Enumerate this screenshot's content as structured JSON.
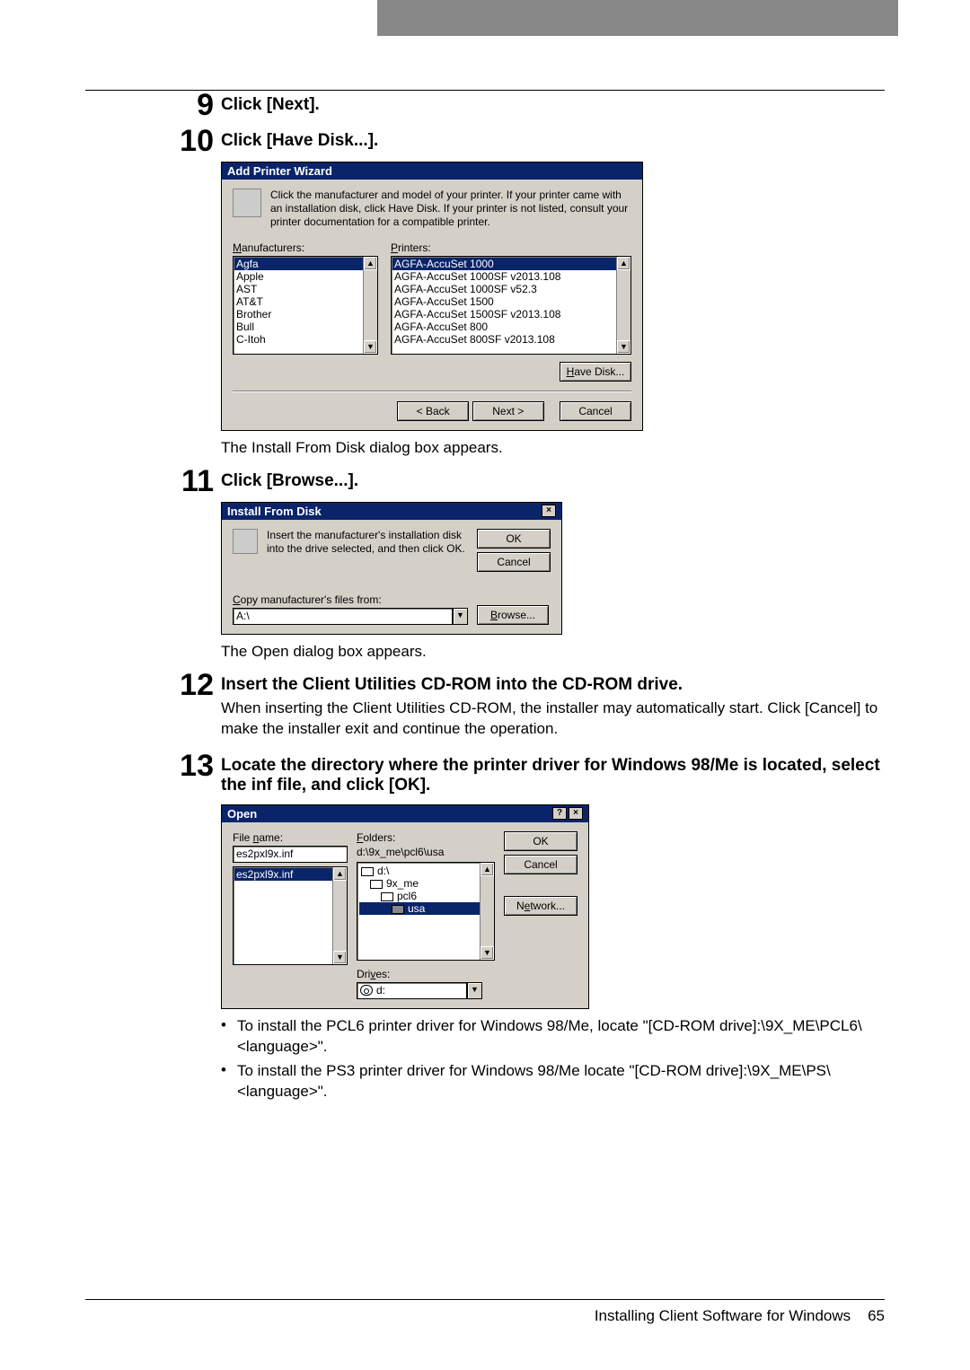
{
  "steps": {
    "s9": {
      "num": "9",
      "title": "Click [Next]."
    },
    "s10": {
      "num": "10",
      "title": "Click [Have Disk...].",
      "after": "The Install From Disk dialog box appears."
    },
    "s11": {
      "num": "11",
      "title": "Click [Browse...].",
      "after": "The Open dialog box appears."
    },
    "s12": {
      "num": "12",
      "title": "Insert the Client Utilities CD-ROM into the CD-ROM drive.",
      "text": "When inserting the Client Utilities CD-ROM, the installer may automatically start. Click [Cancel] to make the installer exit and continue the operation."
    },
    "s13": {
      "num": "13",
      "title": "Locate the directory where the printer driver for Windows 98/Me is located, select the inf file, and click [OK]."
    }
  },
  "bullets": {
    "b1": "To install the PCL6 printer driver for Windows 98/Me, locate \"[CD-ROM drive]:\\9X_ME\\PCL6\\<language>\".",
    "b2": "To install the PS3 printer driver for Windows 98/Me locate \"[CD-ROM drive]:\\9X_ME\\PS\\<language>\"."
  },
  "wizard": {
    "title": "Add Printer Wizard",
    "info": "Click the manufacturer and model of your printer. If your printer came with an installation disk, click Have Disk. If your printer is not listed, consult your printer documentation for a compatible printer.",
    "mfr_label": "Manufacturers:",
    "prn_label": "Printers:",
    "mfrs": [
      "Agfa",
      "Apple",
      "AST",
      "AT&T",
      "Brother",
      "Bull",
      "C-Itoh"
    ],
    "prns": [
      "AGFA-AccuSet 1000",
      "AGFA-AccuSet 1000SF v2013.108",
      "AGFA-AccuSet 1000SF v52.3",
      "AGFA-AccuSet 1500",
      "AGFA-AccuSet 1500SF v2013.108",
      "AGFA-AccuSet 800",
      "AGFA-AccuSet 800SF v2013.108"
    ],
    "have_disk": "Have Disk...",
    "back": "< Back",
    "next": "Next >",
    "cancel": "Cancel"
  },
  "install_from_disk": {
    "title": "Install From Disk",
    "info": "Insert the manufacturer's installation disk into the drive selected, and then click OK.",
    "copy_label": "Copy manufacturer's files from:",
    "path": "A:\\",
    "ok": "OK",
    "cancel": "Cancel",
    "browse": "Browse..."
  },
  "open": {
    "title": "Open",
    "filename_label": "File name:",
    "filename": "es2pxl9x.inf",
    "file_list": [
      "es2pxl9x.inf"
    ],
    "folders_label": "Folders:",
    "path": "d:\\9x_me\\pcl6\\usa",
    "folder_tree": [
      "d:\\",
      "9x_me",
      "pcl6",
      "usa"
    ],
    "drives_label": "Drives:",
    "drive": "d:",
    "ok": "OK",
    "cancel": "Cancel",
    "network": "Network..."
  },
  "footer": {
    "text": "Installing Client Software for Windows",
    "page": "65"
  }
}
